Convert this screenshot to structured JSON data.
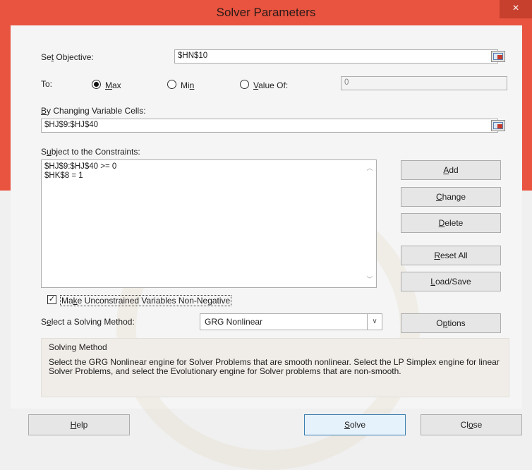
{
  "window": {
    "title": "Solver Parameters",
    "close": "×"
  },
  "objective": {
    "label": "Set Objective:",
    "value": "$HN$10"
  },
  "to": {
    "label": "To:",
    "max": "Max",
    "min": "Min",
    "value_of": "Value Of:",
    "value_of_input": "0",
    "selected": "Max"
  },
  "changing": {
    "label": "By Changing Variable Cells:",
    "value": "$HJ$9:$HJ$40"
  },
  "constraints": {
    "label": "Subject to the Constraints:",
    "items": [
      "$HJ$9:$HJ$40 >= 0",
      "$HK$8 = 1"
    ]
  },
  "buttons": {
    "add": "Add",
    "change": "Change",
    "delete": "Delete",
    "reset_all": "Reset All",
    "load_save": "Load/Save",
    "options": "Options",
    "help": "Help",
    "solve": "Solve",
    "close": "Close"
  },
  "nonneg": {
    "label": "Make Unconstrained Variables Non-Negative",
    "checked": true,
    "mark": "✓"
  },
  "method": {
    "label": "Select a Solving Method:",
    "value": "GRG Nonlinear"
  },
  "info": {
    "title": "Solving Method",
    "text": "Select the GRG Nonlinear engine for Solver Problems that are smooth nonlinear. Select the LP Simplex engine for linear Solver Problems, and select the Evolutionary engine for Solver problems that are non-smooth."
  },
  "icons": [
    "close-icon",
    "range-select-icon",
    "scroll-up-icon",
    "scroll-down-icon",
    "dropdown-arrow-icon",
    "checkmark-icon"
  ]
}
